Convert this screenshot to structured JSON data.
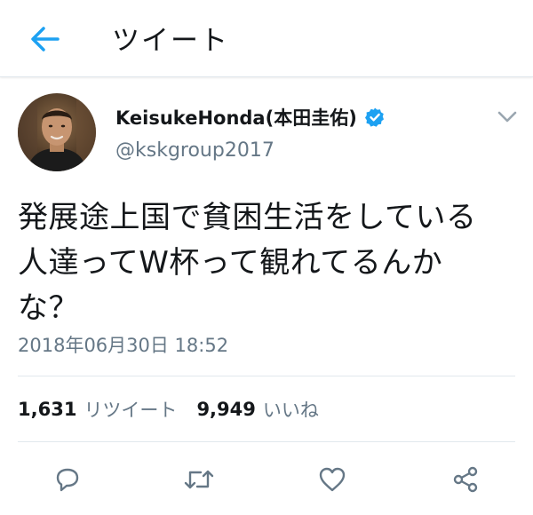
{
  "header": {
    "title": "ツイート",
    "back_icon": "back-arrow-icon",
    "accent_color": "#1da1f2"
  },
  "tweet": {
    "display_name": "KeisukeHonda(本田圭佑)",
    "handle": "@kskgroup2017",
    "verified": true,
    "text_lines": [
      "発展途上国で貧困生活をしている",
      "人達ってW杯って観れてるんか",
      "な？"
    ],
    "timestamp": "2018年06月30日 18:52"
  },
  "stats": {
    "retweets_count": "1,631",
    "retweets_label": "リツイート",
    "likes_count": "9,949",
    "likes_label": "いいね"
  },
  "actions": [
    "reply-icon",
    "retweet-icon",
    "like-icon",
    "share-icon"
  ],
  "colors": {
    "text": "#14171a",
    "secondary": "#657786",
    "divider": "#e1e8ed",
    "verified": "#1da1f2"
  }
}
